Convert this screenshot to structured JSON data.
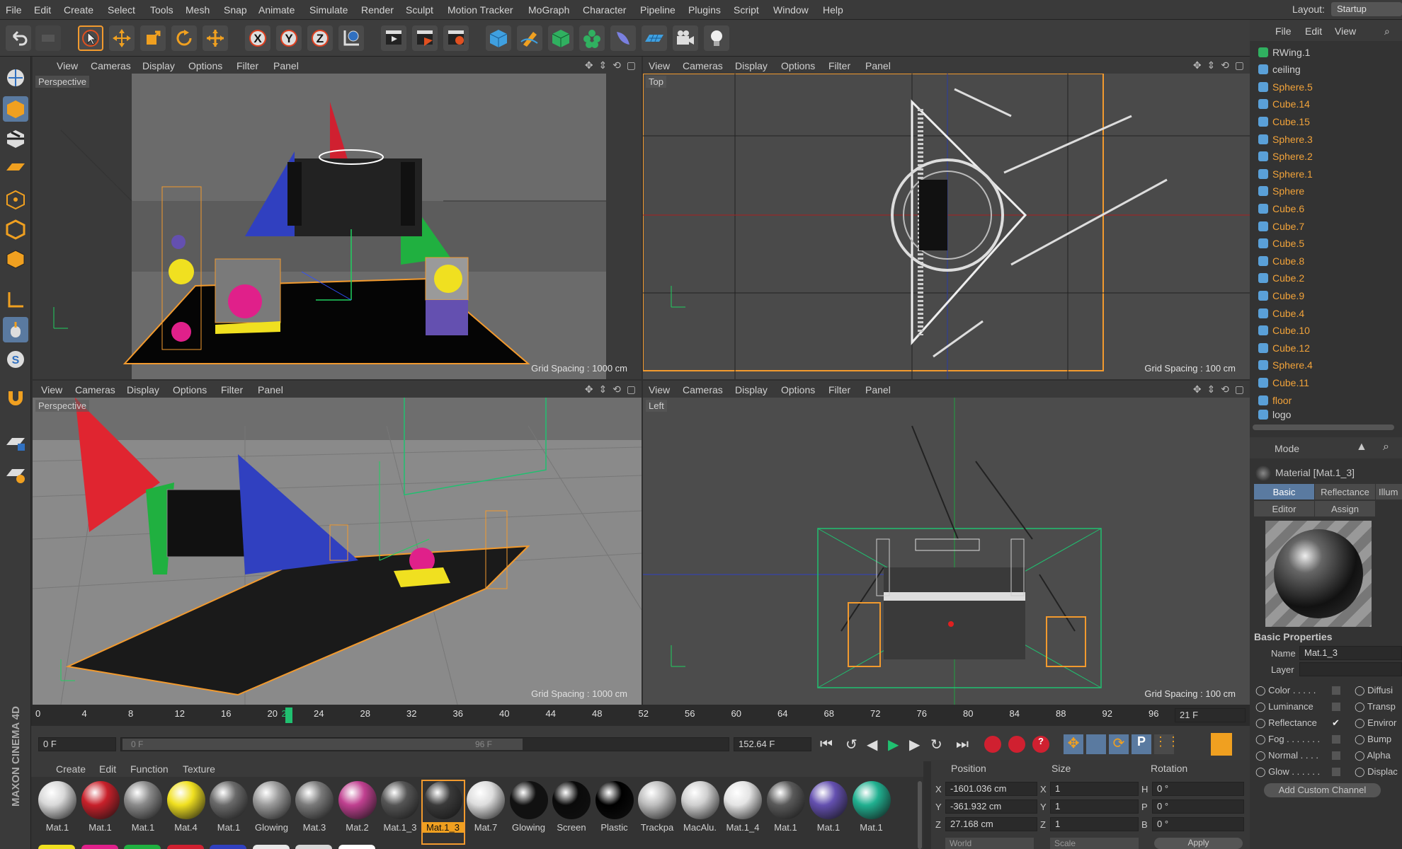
{
  "menubar": {
    "items": [
      "File",
      "Edit",
      "Create",
      "Select",
      "Tools",
      "Mesh",
      "Snap",
      "Animate",
      "Simulate",
      "Render",
      "Sculpt",
      "Motion Tracker",
      "MoGraph",
      "Character",
      "Pipeline",
      "Plugins",
      "Script",
      "Window",
      "Help"
    ],
    "layout_label": "Layout:",
    "layout_value": "Startup"
  },
  "toolbar": {
    "icons": [
      "undo-icon",
      "redo-icon",
      "select-arrow-icon",
      "move-icon",
      "scale-icon",
      "rotate-icon",
      "live-select-icon",
      "x-axis-icon",
      "y-axis-icon",
      "z-axis-icon",
      "world-coord-icon",
      "render-view-icon",
      "render-picture-icon",
      "render-settings-icon",
      "cube-icon",
      "pen-icon",
      "subdivision-icon",
      "cloner-icon",
      "deformer-icon",
      "floor-icon",
      "camera-icon",
      "light-icon"
    ]
  },
  "viewport_menu": [
    "View",
    "Cameras",
    "Display",
    "Options",
    "Filter",
    "Panel"
  ],
  "viewports": {
    "tl": {
      "label": "Perspective",
      "grid": "Grid Spacing : 1000 cm"
    },
    "tr": {
      "label": "Top",
      "grid": "Grid Spacing : 100 cm"
    },
    "bl": {
      "label": "Perspective",
      "grid": "Grid Spacing : 1000 cm"
    },
    "br": {
      "label": "Left",
      "grid": "Grid Spacing : 100 cm"
    }
  },
  "objects": {
    "menu": [
      "File",
      "Edit",
      "View"
    ],
    "items": [
      {
        "name": "RWing.1",
        "plain": true
      },
      {
        "name": "ceiling",
        "plain": true
      },
      {
        "name": "Sphere.5"
      },
      {
        "name": "Cube.14"
      },
      {
        "name": "Cube.15"
      },
      {
        "name": "Sphere.3"
      },
      {
        "name": "Sphere.2"
      },
      {
        "name": "Sphere.1"
      },
      {
        "name": "Sphere"
      },
      {
        "name": "Cube.6"
      },
      {
        "name": "Cube.7"
      },
      {
        "name": "Cube.5"
      },
      {
        "name": "Cube.8"
      },
      {
        "name": "Cube.2"
      },
      {
        "name": "Cube.9"
      },
      {
        "name": "Cube.4"
      },
      {
        "name": "Cube.10"
      },
      {
        "name": "Cube.12"
      },
      {
        "name": "Sphere.4"
      },
      {
        "name": "Cube.11"
      },
      {
        "name": "floor"
      },
      {
        "name": "logo",
        "plain": true
      }
    ]
  },
  "attributes": {
    "mode": "Mode",
    "title": "Material [Mat.1_3]",
    "tabs": [
      "Basic",
      "Reflectance",
      "Illum"
    ],
    "tabs2": [
      "Editor",
      "Assign"
    ],
    "section": "Basic Properties",
    "name_label": "Name",
    "name_value": "Mat.1_3",
    "layer_label": "Layer",
    "channels_left": [
      "Color . . . . .",
      "Luminance",
      "Reflectance",
      "Fog . . . . . . .",
      "Normal . . . .",
      "Glow . . . . . ."
    ],
    "channels_right": [
      "Diffusi",
      "Transp",
      "Enviror",
      "Bump",
      "Alpha",
      "Displac"
    ],
    "add_channel": "Add Custom Channel"
  },
  "timeline": {
    "ticks": [
      "0",
      "4",
      "8",
      "12",
      "16",
      "20",
      "24",
      "28",
      "32",
      "36",
      "40",
      "44",
      "48",
      "52",
      "56",
      "60",
      "64",
      "68",
      "72",
      "76",
      "80",
      "84",
      "88",
      "92",
      "96"
    ],
    "current_tick": "21",
    "current_frame": "21 F",
    "start": "0 F",
    "range_start": "0 F",
    "range_end": "96 F",
    "fps_value": "152.64 F"
  },
  "materials": {
    "menu": [
      "Create",
      "Edit",
      "Function",
      "Texture"
    ],
    "items": [
      {
        "name": "Mat.1",
        "color": "#d8d8d8"
      },
      {
        "name": "Mat.1",
        "color": "#c8202a"
      },
      {
        "name": "Mat.1",
        "color": "#8a8a8a"
      },
      {
        "name": "Mat.4",
        "color": "#f0e020"
      },
      {
        "name": "Mat.1",
        "color": "#6a6a6a"
      },
      {
        "name": "Glowing",
        "color": "#9a9a9a"
      },
      {
        "name": "Mat.3",
        "color": "#7a7a7a"
      },
      {
        "name": "Mat.2",
        "color": "#c04090"
      },
      {
        "name": "Mat.1_3",
        "color": "#555555"
      },
      {
        "name": "Mat.1_3",
        "color": "#3a3a3a",
        "selected": true
      },
      {
        "name": "Mat.7",
        "color": "#dddddd"
      },
      {
        "name": "Glowing",
        "color": "#111111"
      },
      {
        "name": "Screen",
        "color": "#0a0a0a"
      },
      {
        "name": "Plastic",
        "color": "#000000"
      },
      {
        "name": "Trackpa",
        "color": "#bdbdbd"
      },
      {
        "name": "MacAlu.",
        "color": "#cfcfcf"
      },
      {
        "name": "Mat.1_4",
        "color": "#e4e4e4"
      },
      {
        "name": "Mat.1",
        "color": "#5a5a5a"
      },
      {
        "name": "Mat.1",
        "color": "#6450b0"
      },
      {
        "name": "Mat.1",
        "color": "#20b090"
      }
    ],
    "row2_colors": [
      "#f0e020",
      "#e0208a",
      "#20b040",
      "#d02030",
      "#3040c0",
      "#e8e8e8",
      "#d8d8d8",
      "#ffffff"
    ]
  },
  "coords": {
    "h_position": "Position",
    "h_size": "Size",
    "h_rotation": "Rotation",
    "rows": [
      {
        "axis": "X",
        "pos": "-1601.036 cm",
        "size_axis": "X",
        "size": "1",
        "rot_axis": "H",
        "rot": "0 °"
      },
      {
        "axis": "Y",
        "pos": "-361.932 cm",
        "size_axis": "Y",
        "size": "1",
        "rot_axis": "P",
        "rot": "0 °"
      },
      {
        "axis": "Z",
        "pos": "27.168 cm",
        "size_axis": "Z",
        "size": "1",
        "rot_axis": "B",
        "rot": "0 °"
      }
    ],
    "world": "World",
    "scale": "Scale",
    "apply": "Apply"
  },
  "branding": "MAXON CINEMA 4D"
}
